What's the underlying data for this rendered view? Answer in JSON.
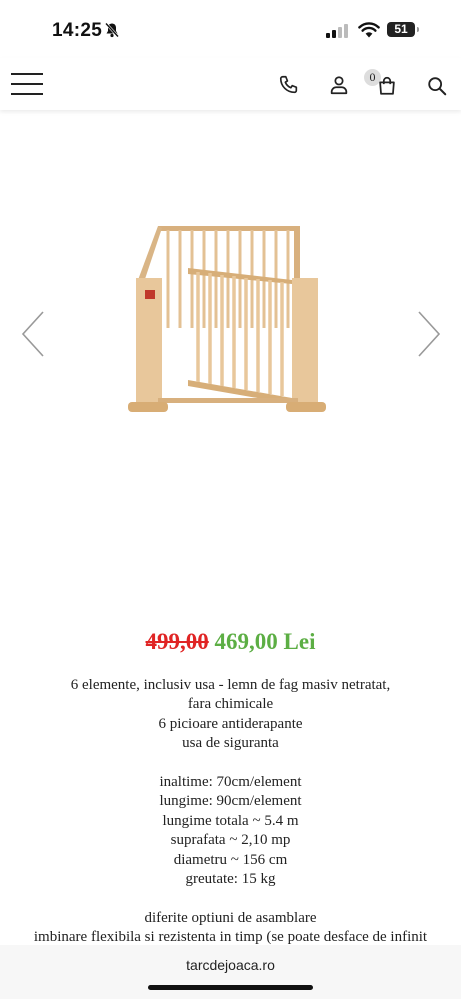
{
  "status_bar": {
    "time": "14:25",
    "battery": "51"
  },
  "header": {
    "cart_count": "0"
  },
  "product": {
    "old_price": "499,00",
    "new_price": "469,00 Lei",
    "description_lines": [
      "6 elemente, inclusiv usa - lemn de fag masiv netratat,",
      "fara chimicale",
      "6 picioare antiderapante",
      "usa de siguranta",
      "",
      "inaltime: 70cm/element",
      "lungime: 90cm/element",
      "lungime totala ~ 5.4 m",
      "suprafata ~ 2,10 mp",
      "diametru ~ 156 cm",
      "greutate: 15 kg",
      "",
      "diferite optiuni de asamblare",
      "imbinare flexibila si rezistenta in timp (se poate desface de infinit"
    ]
  },
  "browser": {
    "url": "tarcdejoaca.ro"
  },
  "colors": {
    "old_price": "#e02424",
    "new_price": "#5cae44"
  }
}
